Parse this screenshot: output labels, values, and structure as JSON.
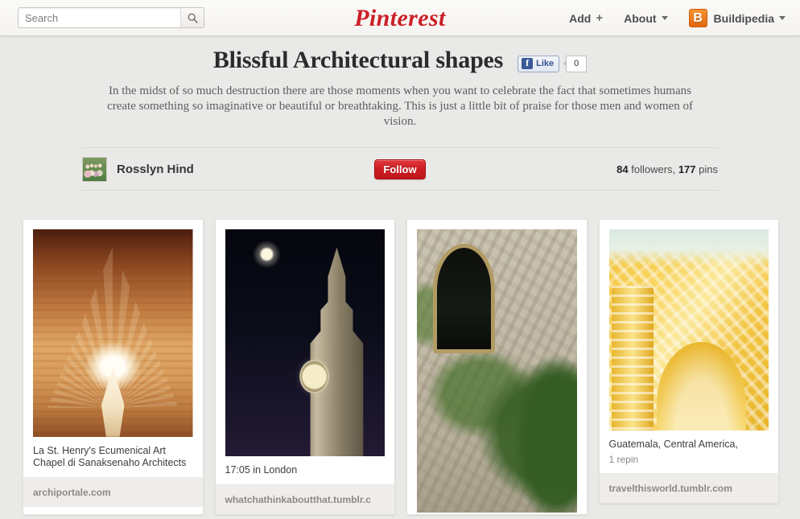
{
  "header": {
    "search": {
      "placeholder": "Search",
      "value": "",
      "icon": "search-icon"
    },
    "logo": "Pinterest",
    "nav": {
      "add_label": "Add",
      "add_icon": "plus-icon",
      "about_label": "About",
      "about_icon": "chevron-down-icon",
      "account_label": "Buildipedia",
      "account_badge": "B",
      "account_icon": "chevron-down-icon"
    }
  },
  "board": {
    "title": "Blissful Architectural shapes",
    "facebook": {
      "like_label": "Like",
      "icon": "facebook-icon",
      "count": "0"
    },
    "description": "In the midst of so much destruction there are those moments when you want to celebrate the fact that sometimes humans create something so imaginative or beautiful or breathtaking. This is just a little bit of praise for those men and women of vision.",
    "user": {
      "name": "Rosslyn Hind",
      "avatar_icon": "avatar",
      "follow_label": "Follow",
      "followers_count": "84",
      "followers_label": "followers,",
      "pins_count": "177",
      "pins_label": "pins"
    }
  },
  "pins": [
    {
      "title": "La St. Henry's Ecumenical Art Chapel di Sanaksenaho Architects",
      "repins": "",
      "source": "archiportale.com",
      "image_name": "wooden-chapel-interior-image"
    },
    {
      "title": "17:05 in London",
      "repins": "",
      "source": "whatchathinkaboutthat.tumblr.c",
      "image_name": "big-ben-at-night-image"
    },
    {
      "title": "",
      "repins": "",
      "source": "",
      "image_name": "ivy-covered-stone-tower-image"
    },
    {
      "title": "Guatemala, Central America,",
      "repins": "1 repin",
      "source": "travelthisworld.tumblr.com",
      "image_name": "yellow-baroque-facade-image"
    }
  ],
  "colors": {
    "brand_red": "#cb2027",
    "follow_red": "#cb1d22",
    "account_orange": "#e2670d",
    "facebook_blue": "#3b5998",
    "page_bg": "#e9e9e7"
  }
}
